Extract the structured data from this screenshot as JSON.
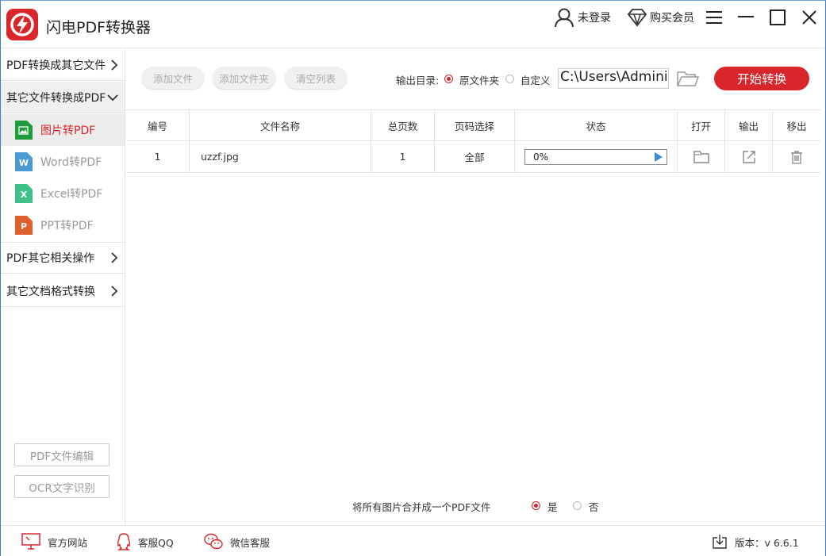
{
  "app": {
    "title": "闪电PDF转换器"
  },
  "titlebar": {
    "login_label": "未登录",
    "vip_label": "购买会员"
  },
  "sidebar": {
    "cat1": "PDF转换成其它文件",
    "cat2": "其它文件转换成PDF",
    "items": [
      {
        "label": "图片转PDF",
        "icon": "image-file-icon",
        "color": "#1f9a3d"
      },
      {
        "label": "Word转PDF",
        "icon": "word-file-icon",
        "color": "#4a9ad4",
        "letter": "W"
      },
      {
        "label": "Excel转PDF",
        "icon": "excel-file-icon",
        "color": "#3fc28a",
        "letter": "X"
      },
      {
        "label": "PPT转PDF",
        "icon": "ppt-file-icon",
        "color": "#e0602d",
        "letter": "P"
      }
    ],
    "cat3": "PDF其它相关操作",
    "cat4": "其它文档格式转换",
    "edit_btn": "PDF文件编辑",
    "ocr_btn": "OCR文字识别"
  },
  "toolbar": {
    "add_file": "添加文件",
    "add_folder": "添加文件夹",
    "clear_list": "清空列表",
    "output_label": "输出目录:",
    "opt_original": "原文件夹",
    "opt_custom": "自定义",
    "path_value": "C:\\Users\\Administ",
    "start_button": "开始转换"
  },
  "table": {
    "headers": [
      "编号",
      "文件名称",
      "总页数",
      "页码选择",
      "状态",
      "打开",
      "输出",
      "移出"
    ],
    "rows": [
      {
        "num": "1",
        "name": "uzzf.jpg",
        "pages": "1",
        "range": "全部",
        "status": "0%",
        "progress": 0
      }
    ]
  },
  "merge": {
    "label": "将所有图片合并成一个PDF文件",
    "yes": "是",
    "no": "否"
  },
  "footer": {
    "website": "官方网站",
    "qq": "客服QQ",
    "wechat": "微信客服",
    "version": "版本：v 6.6.1"
  },
  "colors": {
    "accent": "#d9262b",
    "border": "#3c7fd0"
  }
}
